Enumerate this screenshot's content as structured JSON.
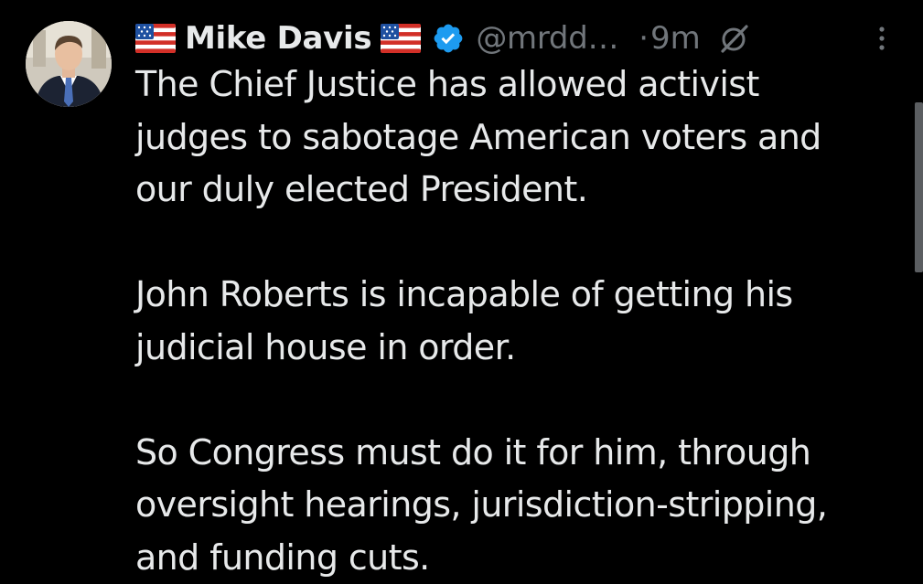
{
  "tweet": {
    "author": {
      "display_name": "Mike Davis",
      "name_flag_before": "us-flag-icon",
      "name_flag_after": "us-flag-icon",
      "verified_badge": "verified-badge-icon",
      "handle": "@mrdd…",
      "avatar": "avatar-photo"
    },
    "separator": "·",
    "time_ago": "9m",
    "grok_icon": "grok-icon",
    "more_icon": "more-options-icon",
    "paragraphs": [
      "The Chief Justice has allowed activist\njudges to sabotage American voters and\nour duly elected President.",
      "John Roberts is incapable of getting his\njudicial house in order.",
      "So Congress must do it for him, through\noversight hearings, jurisdiction-stripping,\nand funding cuts."
    ]
  },
  "colors": {
    "background": "#000000",
    "primary_text": "#e7e9ea",
    "secondary_text": "#71767b",
    "verified_blue": "#1d9bf0"
  }
}
